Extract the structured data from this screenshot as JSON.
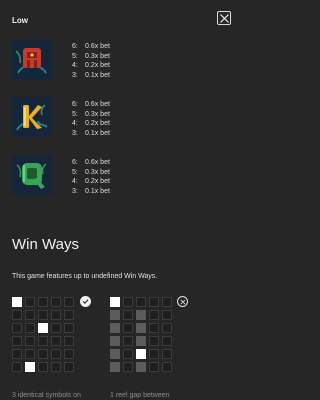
{
  "header": {
    "section_title": "Low",
    "close_icon": "close-icon"
  },
  "symbols": [
    {
      "name": "A",
      "color": "#d8432f",
      "pays": [
        {
          "count": "6:",
          "value": "0.6x bet"
        },
        {
          "count": "5:",
          "value": "0.3x bet"
        },
        {
          "count": "4:",
          "value": "0.2x bet"
        },
        {
          "count": "3:",
          "value": "0.1x bet"
        }
      ]
    },
    {
      "name": "K",
      "color": "#e8b52a",
      "pays": [
        {
          "count": "6:",
          "value": "0.6x bet"
        },
        {
          "count": "5:",
          "value": "0.3x bet"
        },
        {
          "count": "4:",
          "value": "0.2x bet"
        },
        {
          "count": "3:",
          "value": "0.1x bet"
        }
      ]
    },
    {
      "name": "Q",
      "color": "#3cab57",
      "pays": [
        {
          "count": "6:",
          "value": "0.6x bet"
        },
        {
          "count": "5:",
          "value": "0.3x bet"
        },
        {
          "count": "4:",
          "value": "0.2x bet"
        },
        {
          "count": "3:",
          "value": "0.1x bet"
        }
      ]
    }
  ],
  "win_ways": {
    "title": "Win Ways",
    "description": "This game features up to undefined Win Ways.",
    "examples": [
      {
        "caption": "3 identical symbols on",
        "status_icon": "check-circle-icon",
        "valid": true,
        "grid": [
          [
            1,
            0,
            0,
            0,
            0
          ],
          [
            0,
            0,
            0,
            0,
            0
          ],
          [
            0,
            0,
            1,
            0,
            0
          ],
          [
            0,
            0,
            0,
            0,
            0
          ],
          [
            0,
            0,
            0,
            0,
            0
          ],
          [
            0,
            1,
            0,
            0,
            0
          ]
        ]
      },
      {
        "caption": "1 reel gap between",
        "status_icon": "cross-circle-icon",
        "valid": false,
        "grid": [
          [
            1,
            0,
            0,
            0,
            0
          ],
          [
            2,
            0,
            2,
            0,
            0
          ],
          [
            2,
            0,
            2,
            0,
            0
          ],
          [
            2,
            0,
            2,
            0,
            0
          ],
          [
            2,
            0,
            1,
            0,
            0
          ],
          [
            2,
            0,
            2,
            0,
            0
          ]
        ]
      }
    ]
  }
}
